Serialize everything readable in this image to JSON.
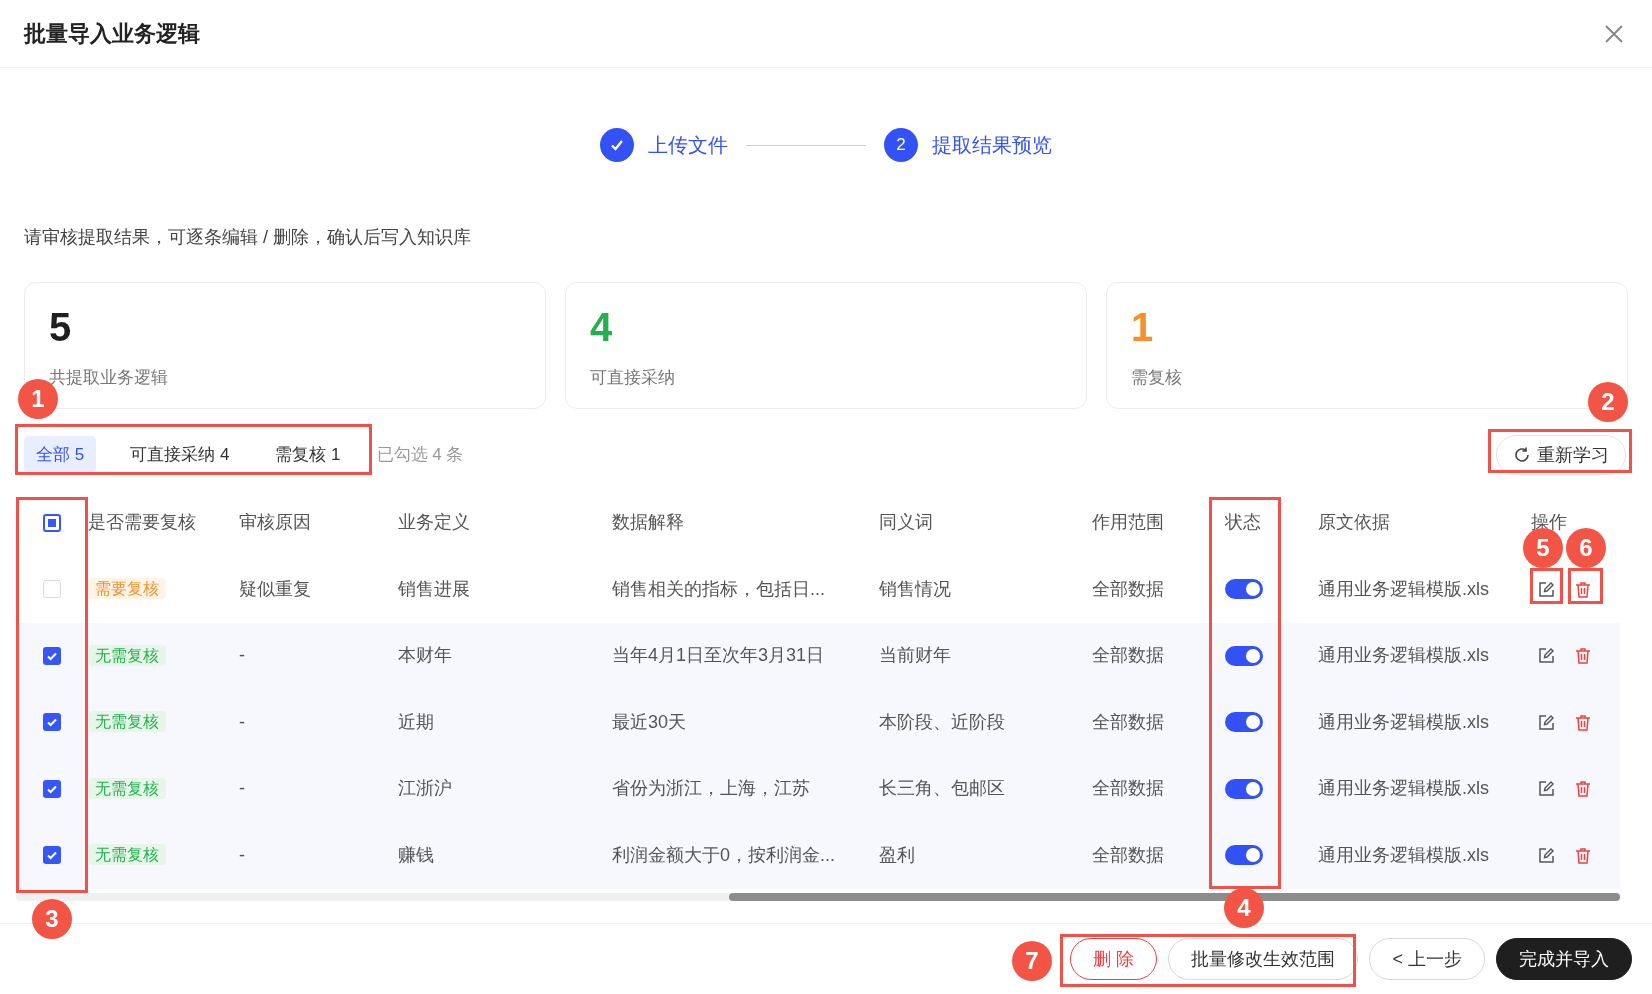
{
  "dialog": {
    "title": "批量导入业务逻辑"
  },
  "steps": [
    {
      "label": "上传文件",
      "done": true
    },
    {
      "label": "提取结果预览",
      "number": "2",
      "done": false
    }
  ],
  "instruction": "请审核提取结果，可逐条编辑 / 删除，确认后写入知识库",
  "stats": [
    {
      "value": "5",
      "label": "共提取业务逻辑",
      "color": "#1f1f1f"
    },
    {
      "value": "4",
      "label": "可直接采纳",
      "color": "#22b14c"
    },
    {
      "value": "1",
      "label": "需复核",
      "color": "#f7902b"
    }
  ],
  "filter_tabs": [
    {
      "label": "全部 5",
      "selected": true
    },
    {
      "label": "可直接采纳 4",
      "selected": false
    },
    {
      "label": "需复核 1",
      "selected": false
    }
  ],
  "selection_count": "已勾选 4 条",
  "relearn_button": "重新学习",
  "table": {
    "select_all_partial": true,
    "columns": [
      "是否需要复核",
      "审核原因",
      "业务定义",
      "数据解释",
      "同义词",
      "作用范围",
      "状态",
      "原文依据",
      "操作"
    ],
    "rows": [
      {
        "checked": false,
        "review": {
          "label": "需要复核",
          "kind": "warning"
        },
        "reason": "疑似重复",
        "definition": "销售进展",
        "explanation": "销售相关的指标，包括日...",
        "synonyms": "销售情况",
        "scope": "全部数据",
        "on": true,
        "source": "通用业务逻辑模版.xls"
      },
      {
        "checked": true,
        "review": {
          "label": "无需复核",
          "kind": "ok"
        },
        "reason": "-",
        "definition": "本财年",
        "explanation": "当年4月1日至次年3月31日",
        "synonyms": "当前财年",
        "scope": "全部数据",
        "on": true,
        "source": "通用业务逻辑模版.xls"
      },
      {
        "checked": true,
        "review": {
          "label": "无需复核",
          "kind": "ok"
        },
        "reason": "-",
        "definition": "近期",
        "explanation": "最近30天",
        "synonyms": "本阶段、近阶段",
        "scope": "全部数据",
        "on": true,
        "source": "通用业务逻辑模版.xls"
      },
      {
        "checked": true,
        "review": {
          "label": "无需复核",
          "kind": "ok"
        },
        "reason": "-",
        "definition": "江浙沪",
        "explanation": "省份为浙江，上海，江苏",
        "synonyms": "长三角、包邮区",
        "scope": "全部数据",
        "on": true,
        "source": "通用业务逻辑模版.xls"
      },
      {
        "checked": true,
        "review": {
          "label": "无需复核",
          "kind": "ok"
        },
        "reason": "-",
        "definition": "赚钱",
        "explanation": "利润金额大于0，按利润金...",
        "synonyms": "盈利",
        "scope": "全部数据",
        "on": true,
        "source": "通用业务逻辑模版.xls"
      }
    ]
  },
  "footer_buttons": [
    {
      "label": "删 除",
      "kind": "danger"
    },
    {
      "label": "批量修改生效范围",
      "kind": "default"
    },
    {
      "label": "< 上一步",
      "kind": "default"
    },
    {
      "label": "完成并导入",
      "kind": "primary"
    }
  ],
  "callouts": [
    {
      "number": "1"
    },
    {
      "number": "2"
    },
    {
      "number": "3"
    },
    {
      "number": "4"
    },
    {
      "number": "5"
    },
    {
      "number": "6"
    },
    {
      "number": "7"
    }
  ]
}
